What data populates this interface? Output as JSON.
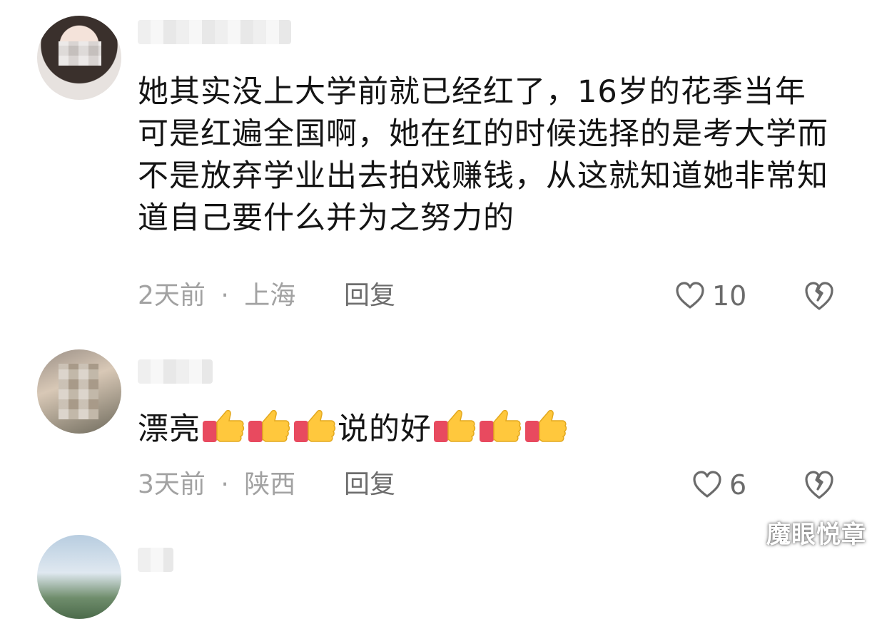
{
  "comments": [
    {
      "text": "她其实没上大学前就已经红了，16岁的花季当年可是红遍全国啊，她在红的时候选择的是考大学而不是放弃学业出去拍戏赚钱，从这就知道她非常知道自己要什么并为之努力的",
      "time": "2天前",
      "location": "上海",
      "reply_label": "回复",
      "likes": "10"
    },
    {
      "text_before": "漂亮",
      "text_middle": "说的好",
      "time": "3天前",
      "location": "陕西",
      "reply_label": "回复",
      "likes": "6"
    }
  ],
  "meta_separator": "·",
  "watermark": "魔眼悦章",
  "colors": {
    "icon": "#6b6b6b",
    "meta": "#a2a2a2",
    "thumb_yellow": "#ffc83d",
    "thumb_cuff": "#e84a5f"
  }
}
